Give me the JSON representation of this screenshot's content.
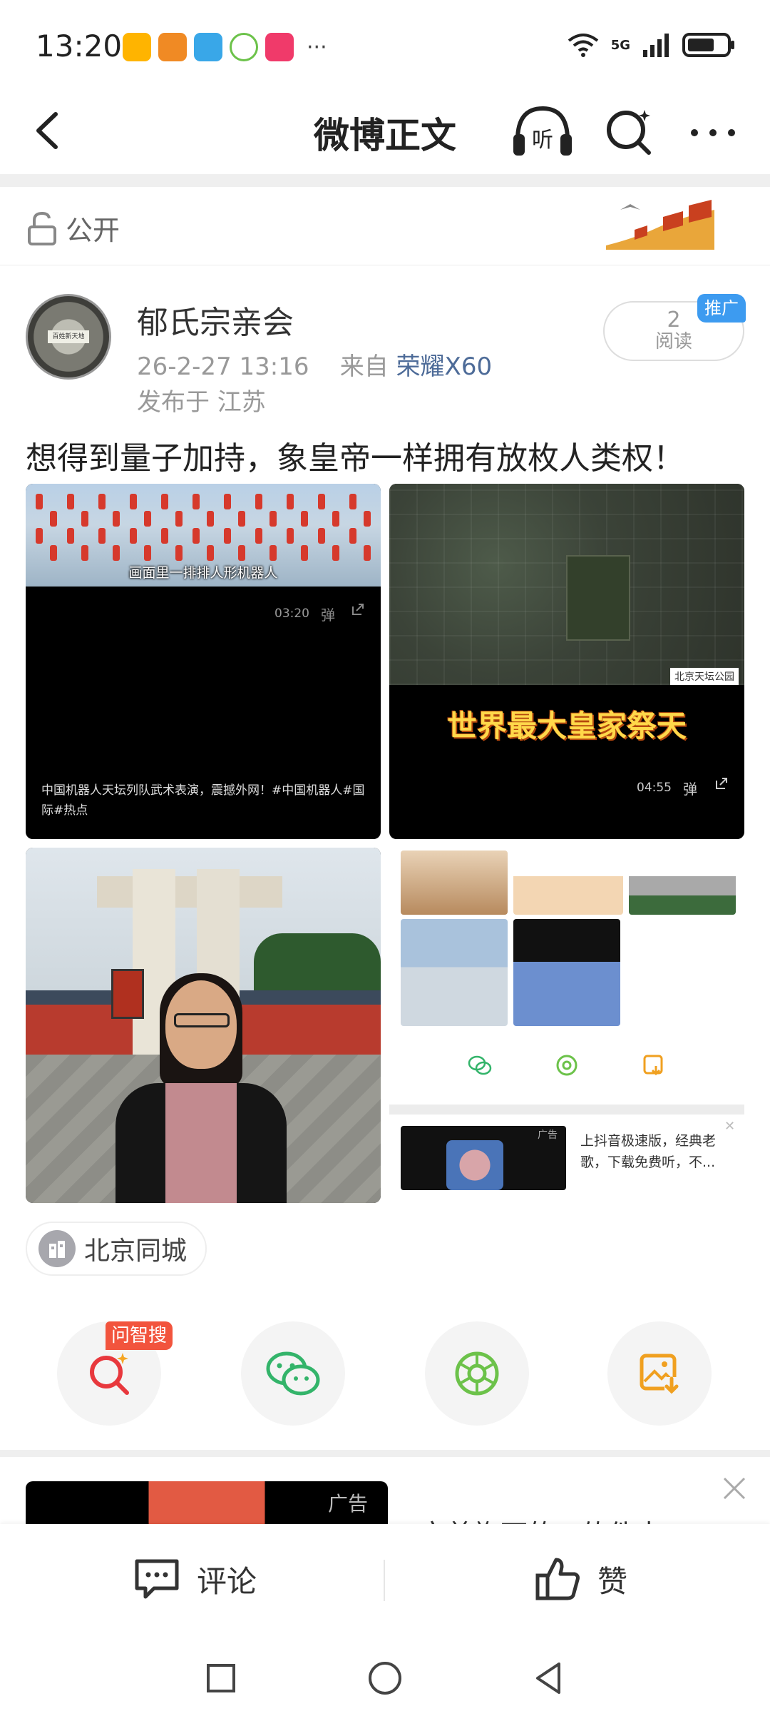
{
  "status_bar": {
    "time": "13:20",
    "network": "5G",
    "more": "···"
  },
  "nav": {
    "title": "微博正文",
    "listen_label": "听"
  },
  "visibility": {
    "label": "公开"
  },
  "post": {
    "author": "郁氏宗亲会",
    "avatar_text": "百姓新天地",
    "time": "26-2-27 13:16",
    "via_prefix": "来自",
    "device": "荣耀X60",
    "location": "发布于 江苏",
    "read_count": "2",
    "read_label": "阅读",
    "promo_badge": "推广",
    "text": "想得到量子加持，象皇帝一样拥有放枚人类权！"
  },
  "images": {
    "img1": {
      "caption": "画面里一排排人形机器人",
      "duration": "03:20",
      "danmaku": "弹",
      "description": "中国机器人天坛列队武术表演，震撼外网！#中国机器人#国际#热点"
    },
    "img2": {
      "map_label": "北京天坛公园",
      "caption": "世界最大皇家祭天",
      "duration": "04:55",
      "danmaku": "弹"
    },
    "img4": {
      "ad_tag": "广告",
      "ad_text": "上抖音极速版，经典老歌，下载免费听，不..."
    }
  },
  "location_chip": {
    "label": "北京同城"
  },
  "actions": {
    "ask_badge": "问智搜"
  },
  "ad_card": {
    "tag": "广告",
    "title": "完美旗下的AI软件未"
  },
  "bottom_bar": {
    "comment_label": "评论",
    "like_label": "赞"
  }
}
